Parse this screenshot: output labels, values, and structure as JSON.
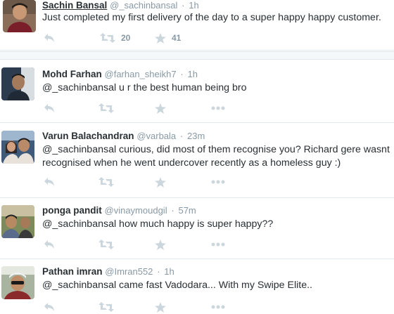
{
  "tweets": [
    {
      "name": "Sachin Bansal",
      "handle": "@_sachinbansal",
      "time": "1h",
      "text": "Just completed my first delivery of the day to a super happy happy customer.",
      "retweets": "20",
      "favorites": "41"
    },
    {
      "name": "Mohd Farhan",
      "handle": "@farhan_sheikh7",
      "time": "1h",
      "text": "@_sachinbansal u r the best human being bro",
      "retweets": "",
      "favorites": ""
    },
    {
      "name": "Varun Balachandran",
      "handle": "@varbala",
      "time": "23m",
      "text": "@_sachinbansal curious, did most of them recognise you?  Richard gere wasnt recognised when he went undercover recently as a homeless guy :)",
      "retweets": "",
      "favorites": ""
    },
    {
      "name": "ponga pandit",
      "handle": "@vinaymoudgil",
      "time": "57m",
      "text": "@_sachinbansal how much happy is super happy??",
      "retweets": "",
      "favorites": ""
    },
    {
      "name": "Pathan imran",
      "handle": "@Imran552",
      "time": "1h",
      "text": "@_sachinbansal came fast Vadodara... With my Swipe Elite..",
      "retweets": "",
      "favorites": ""
    }
  ],
  "separator": "·",
  "colors": {
    "text": "#292f33",
    "muted": "#8899a6",
    "icon": "#ccd6dd",
    "border": "#e1e8ed"
  }
}
